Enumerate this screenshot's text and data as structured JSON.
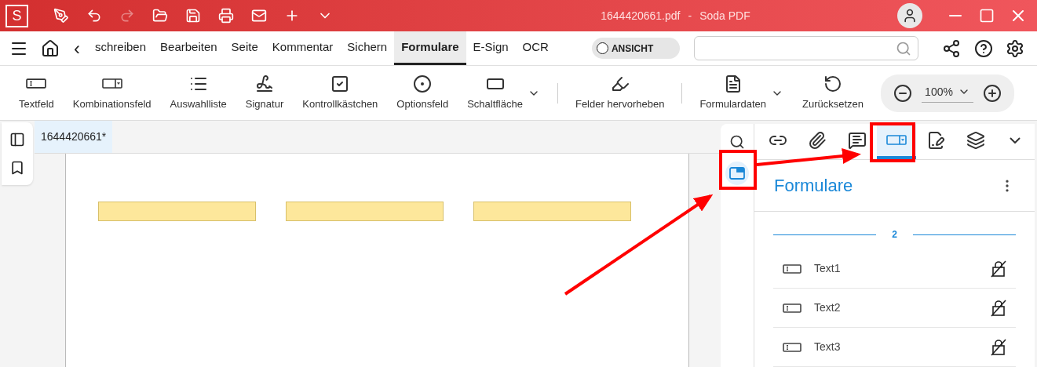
{
  "title_bar": {
    "logo": "S",
    "file": "1644420661.pdf",
    "separator": "-",
    "app": "Soda PDF"
  },
  "menu": {
    "back": "‹",
    "tabs": [
      {
        "label": "schreiben",
        "selected": false
      },
      {
        "label": "Bearbeiten",
        "selected": false
      },
      {
        "label": "Seite",
        "selected": false
      },
      {
        "label": "Kommentar",
        "selected": false
      },
      {
        "label": "Sichern",
        "selected": false
      },
      {
        "label": "Formulare",
        "selected": true
      },
      {
        "label": "E-Sign",
        "selected": false
      },
      {
        "label": "OCR",
        "selected": false
      }
    ],
    "view_toggle": {
      "label": "ANSICHT",
      "on": false
    }
  },
  "toolbar": {
    "tools": [
      {
        "kind": "textfield",
        "label": "Textfeld"
      },
      {
        "kind": "combo",
        "label": "Kombinationsfeld"
      },
      {
        "kind": "list",
        "label": "Auswahlliste"
      },
      {
        "kind": "signature",
        "label": "Signatur"
      },
      {
        "kind": "checkbox",
        "label": "Kontrollkästchen"
      },
      {
        "kind": "radio",
        "label": "Optionsfeld"
      },
      {
        "kind": "button",
        "label": "Schaltfläche",
        "menu": true
      },
      {
        "kind": "highlight",
        "label": "Felder hervorheben",
        "divider": true
      },
      {
        "kind": "formdata",
        "label": "Formulardaten",
        "menu": true,
        "divider": true
      },
      {
        "kind": "reset",
        "label": "Zurücksetzen"
      }
    ],
    "zoom": "100%"
  },
  "document_tab": "1644420661*",
  "side_strip": [
    {
      "kind": "search",
      "selected": false
    },
    {
      "kind": "forms",
      "selected": true
    }
  ],
  "panel": {
    "tabs": [
      {
        "kind": "link",
        "selected": false
      },
      {
        "kind": "attachment",
        "selected": false
      },
      {
        "kind": "comment",
        "selected": false
      },
      {
        "kind": "forms",
        "selected": true
      },
      {
        "kind": "signature",
        "selected": false
      },
      {
        "kind": "layers",
        "selected": false
      },
      {
        "kind": "more",
        "selected": false
      }
    ],
    "title": "Formulare",
    "page": "2",
    "fields": [
      {
        "name": "Text1",
        "kind": "text"
      },
      {
        "name": "Text2",
        "kind": "text"
      },
      {
        "name": "Text3",
        "kind": "text"
      }
    ]
  }
}
